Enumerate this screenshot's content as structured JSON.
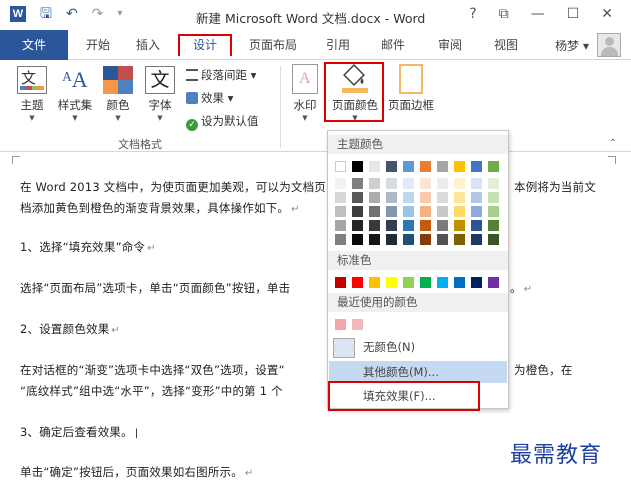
{
  "window": {
    "title": "新建 Microsoft Word 文档.docx - Word",
    "controls": [
      "?",
      "⧉",
      "—",
      "☐",
      "✕"
    ]
  },
  "quick_access": {
    "icons": [
      "word-logo",
      "save-icon",
      "undo-icon",
      "redo-icon",
      "customize-icon"
    ]
  },
  "tabs": [
    {
      "label": "文件",
      "active": false
    },
    {
      "label": "开始",
      "active": false
    },
    {
      "label": "插入",
      "active": false
    },
    {
      "label": "设计",
      "active": true
    },
    {
      "label": "页面布局",
      "active": false
    },
    {
      "label": "引用",
      "active": false
    },
    {
      "label": "邮件",
      "active": false
    },
    {
      "label": "审阅",
      "active": false
    },
    {
      "label": "视图",
      "active": false
    }
  ],
  "user": {
    "name": "杨梦 ▾"
  },
  "ribbon": {
    "theme": "主题",
    "style_set": "样式集",
    "colors": "颜色",
    "fonts": "字体",
    "paragraph_spacing": "段落间距 ▾",
    "effects": "效果 ▾",
    "set_default": "设为默认值",
    "group_label": "文档格式",
    "watermark": "水印",
    "page_color": "页面颜色",
    "page_borders": "页面边框"
  },
  "dropdown": {
    "theme_colors_header": "主题颜色",
    "standard_colors_header": "标准色",
    "recent_colors_header": "最近使用的颜色",
    "no_color": "无颜色(N)",
    "more_colors": "其他颜色(M)...",
    "fill_effects": "填充效果(F)...",
    "theme_colors": [
      [
        "#ffffff",
        "#f2f2f2",
        "#d8d8d8",
        "#bfbfbf",
        "#a5a5a5",
        "#7f7f7f"
      ],
      [
        "#000000",
        "#7f7f7f",
        "#595959",
        "#3f3f3f",
        "#262626",
        "#0c0c0c"
      ],
      [
        "#e7e6e6",
        "#d0cece",
        "#aeabab",
        "#757171",
        "#3a3838",
        "#171616"
      ],
      [
        "#44546a",
        "#d6dce4",
        "#adb9ca",
        "#8496b0",
        "#333f4f",
        "#222a35"
      ],
      [
        "#5b9bd5",
        "#deebf6",
        "#bdd7ee",
        "#9cc3e5",
        "#2e75b5",
        "#1e4e79"
      ],
      [
        "#ed7d31",
        "#fbe5d5",
        "#f7cbac",
        "#f4b183",
        "#c55a11",
        "#833c0b"
      ],
      [
        "#a5a5a5",
        "#ededed",
        "#dbdbdb",
        "#c9c9c9",
        "#7b7b7b",
        "#525252"
      ],
      [
        "#ffc000",
        "#fff2cc",
        "#fee599",
        "#ffd965",
        "#bf9000",
        "#7f6000"
      ],
      [
        "#4472c4",
        "#dae3f3",
        "#b4c7e7",
        "#8faadc",
        "#2f5496",
        "#1f3864"
      ],
      [
        "#70ad47",
        "#e2efd9",
        "#c5e0b3",
        "#a8d08d",
        "#538135",
        "#375623"
      ]
    ],
    "standard_colors": [
      "#c00000",
      "#ff0000",
      "#ffc000",
      "#ffff00",
      "#92d050",
      "#00b050",
      "#00b0f0",
      "#0070c0",
      "#002060",
      "#7030a0"
    ],
    "recent_colors": [
      "#f4a7a7",
      "#f4b8b8"
    ]
  },
  "document": {
    "lines": [
      "在 Word 2013 文档中，为使页面更加美观，可以为文档页",
      "档添加黄色到橙色的渐变背景效果，具体操作如下。",
      "1、选择“填充效果”命令",
      "选择“页面布局”选项卡，单击“页面颜色”按钮，单击",
      "2、设置颜色效果",
      "在对话框的“渐变”选项卡中选择“双色”选项，设置“",
      "“底纹样式”组中选“水平”，选择“变形”中的第 1 个",
      "3、确定后查看效果。",
      "单击“确定”按钮后，页面效果如右图所示。"
    ],
    "right_fragments": [
      "本例将为当前文",
      "。",
      "为橙色，在"
    ]
  },
  "watermark_brand": "最需教育"
}
